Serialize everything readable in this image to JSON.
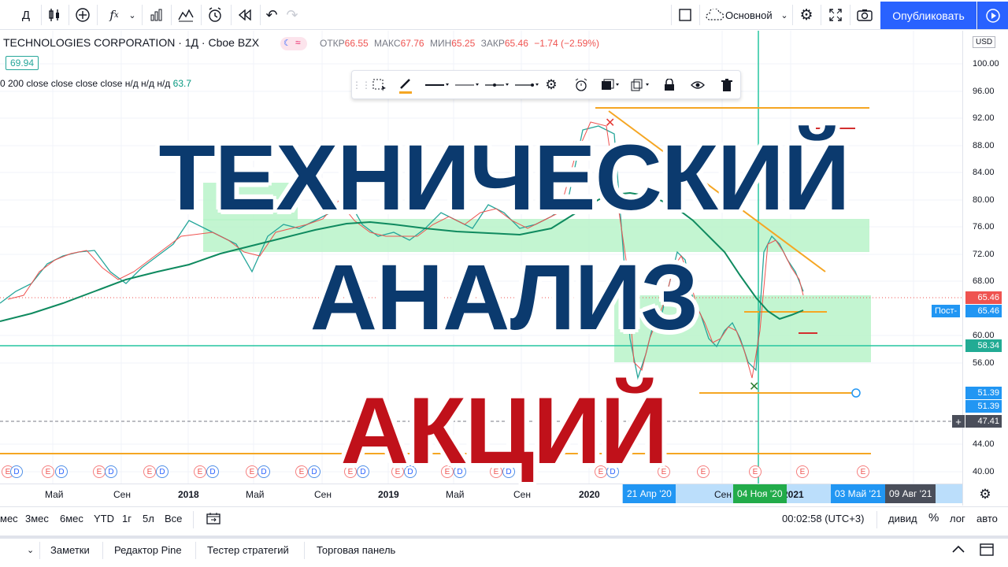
{
  "toolbar": {
    "interval": "Д",
    "layout_label": "Основной",
    "publish_label": "Опубликовать"
  },
  "symbol": {
    "title": "TECHNOLOGIES CORPORATION · 1Д · Cboe BZX",
    "ohlc_open_label": "ОТКР",
    "ohlc_open": "66.55",
    "ohlc_high_label": "МАКС",
    "ohlc_high": "67.76",
    "ohlc_low_label": "МИН",
    "ohlc_low": "65.25",
    "ohlc_close_label": "ЗАКР",
    "ohlc_close": "65.46",
    "ohlc_change": "−1.74 (−2.59%)",
    "last_tag": "69.94",
    "ma_text": "0 200 close close close close  н/д  н/д  н/д",
    "ma_value": "63.7"
  },
  "price_scale": {
    "currency": "USD",
    "labels": [
      "100.00",
      "96.00",
      "92.00",
      "88.00",
      "84.00",
      "80.00",
      "76.00",
      "72.00",
      "68.00",
      "60.00",
      "56.00",
      "44.00",
      "40.00"
    ],
    "tag_current": "65.46",
    "tag_post_label": "Пост-",
    "tag_post": "65.46",
    "tag_line": "58.34",
    "tag_a": "51.39",
    "tag_b": "51.39",
    "tag_cross": "47.41",
    "cross_plus": "+"
  },
  "time_scale": {
    "labels": [
      "Май",
      "Сен",
      "2018",
      "Май",
      "Сен",
      "2019",
      "Май",
      "Сен",
      "2020",
      "Сен",
      "2021"
    ],
    "tag_start": "21 Апр '20",
    "tag_mid": "04 Ноя '20",
    "tag_end1": "03 Май '21",
    "tag_end2": "09 Авг '21"
  },
  "range_bar": {
    "items": [
      "мес",
      "3мес",
      "6мес",
      "YTD",
      "1г",
      "5л",
      "Все"
    ],
    "clock": "00:02:58 (UTC+3)",
    "right": [
      "дивид",
      "%",
      "лог",
      "авто"
    ]
  },
  "panel": {
    "tabs": [
      "Заметки",
      "Редактор Pine",
      "Тестер стратегий",
      "Торговая панель"
    ]
  },
  "overlay": {
    "line1": "ТЕХНИЧЕСКИЙ",
    "line2": "АНАЛИЗ",
    "line3": "АКЦИЙ"
  },
  "colors": {
    "accent": "#2962ff",
    "title_blue": "#0b3a6e",
    "title_red": "#c0111a",
    "zone_green": "#b9f3c9",
    "ma_green": "#0f8a5f",
    "line_orange": "#f5a623"
  }
}
